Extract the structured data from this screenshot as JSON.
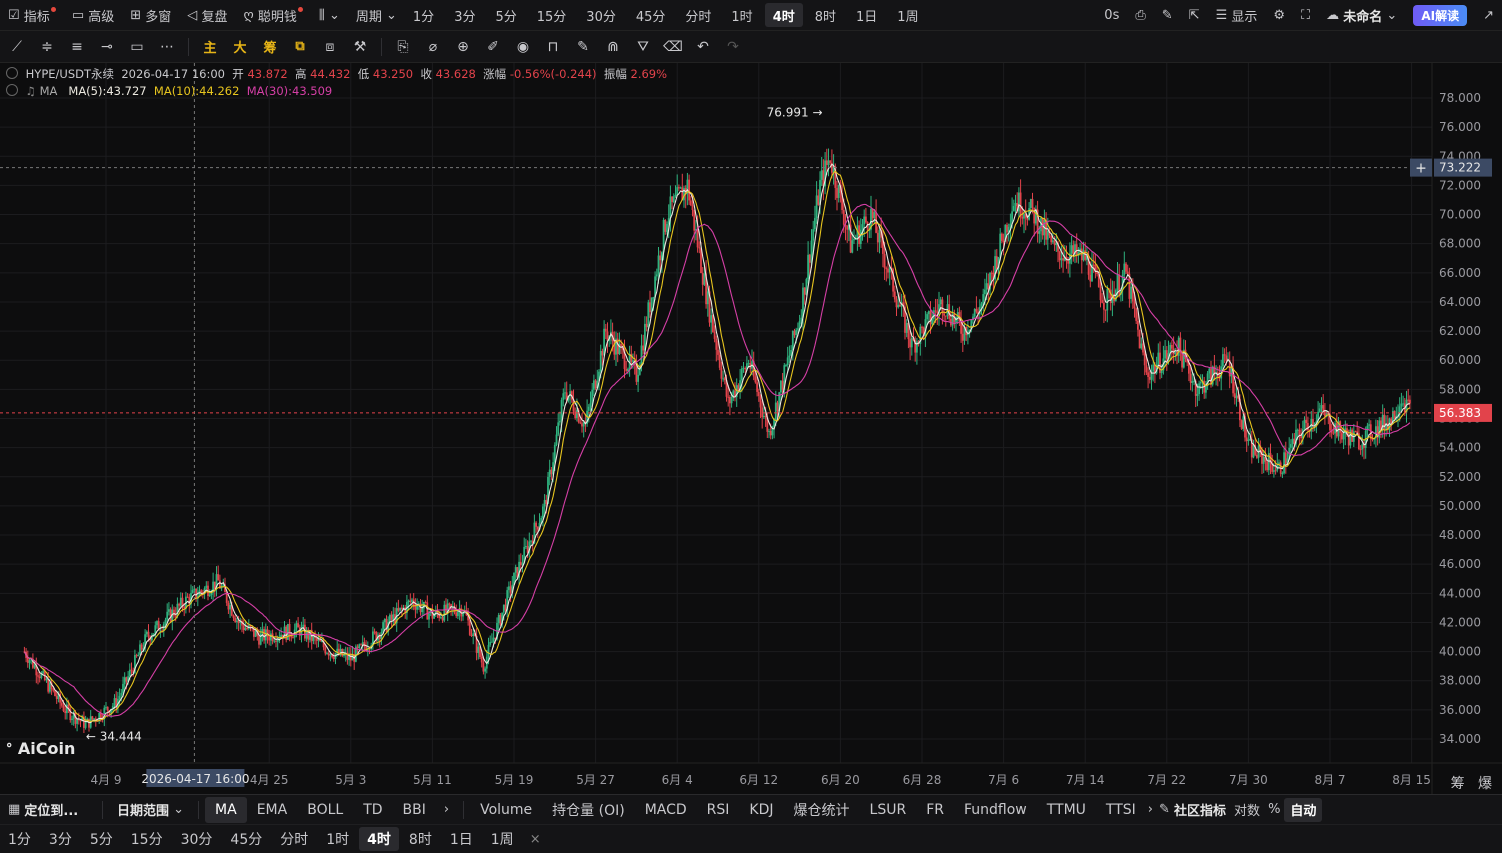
{
  "topbar": {
    "indicators": "指标",
    "advanced": "高级",
    "multi": "多窗",
    "replay": "复盘",
    "smart": "聪明钱",
    "period": "周期",
    "intervals": [
      "1分",
      "3分",
      "5分",
      "15分",
      "30分",
      "45分",
      "分时",
      "1时",
      "4时",
      "8时",
      "1日",
      "1周"
    ],
    "active_interval": "4时",
    "latency": "0s",
    "display": "显示",
    "account": "未命名",
    "ai": "AI解读"
  },
  "toolbar": {
    "main": "主",
    "big": "大",
    "chip": "筹"
  },
  "legend": {
    "symbol": "HYPE/USDT永续",
    "date": "2026-04-17 16:00",
    "open_label": "开",
    "open": "43.872",
    "high_label": "高",
    "high": "44.432",
    "low_label": "低",
    "low": "43.250",
    "close_label": "收",
    "close": "43.628",
    "chg_label": "涨幅",
    "chg": "-0.56%(-0.244)",
    "amp_label": "振幅",
    "amp": "2.69%",
    "ma_name": "MA",
    "ma5": "MA(5):43.727",
    "ma10": "MA(10):44.262",
    "ma30": "MA(30):43.509"
  },
  "colors": {
    "up": "#2fb27f",
    "down": "#e2434b",
    "ma5": "#ece9e0",
    "ma10": "#e7c51f",
    "ma30": "#d53fa6",
    "price": "#e2434b"
  },
  "chart_data": {
    "type": "candlestick",
    "ylim": [
      33,
      79
    ],
    "yticks": [
      "34.000",
      "36.000",
      "38.000",
      "40.000",
      "42.000",
      "44.000",
      "46.000",
      "48.000",
      "50.000",
      "52.000",
      "54.000",
      "56.000",
      "58.000",
      "60.000",
      "62.000",
      "64.000",
      "66.000",
      "68.000",
      "70.000",
      "72.000",
      "74.000",
      "76.000",
      "78.000"
    ],
    "xticks": [
      "4月 9",
      "4月 25",
      "5月 3",
      "5月 11",
      "5月 19",
      "5月 27",
      "6月 4",
      "6月 12",
      "6月 20",
      "6月 28",
      "7月 6",
      "7月 14",
      "7月 22",
      "7月 30",
      "8月 7",
      "8月 15"
    ],
    "crosshair_date": "2026-04-17 16:00",
    "crosshair_price": "73.222",
    "last_price": "56.383",
    "max_label": "76.991",
    "min_label": "34.444",
    "close_path": [
      [
        "4月 1",
        40.0
      ],
      [
        "4月 5",
        36.0
      ],
      [
        "4月 7",
        35.0
      ],
      [
        "4月 10",
        36.5
      ],
      [
        "4月 13",
        41.0
      ],
      [
        "4月 17",
        43.6
      ],
      [
        "4月 20",
        44.8
      ],
      [
        "4月 22",
        42.0
      ],
      [
        "4月 24",
        41.0
      ],
      [
        "4月 28",
        41.5
      ],
      [
        "5月 1",
        40.0
      ],
      [
        "5月 3",
        39.5
      ],
      [
        "5月 6",
        41.5
      ],
      [
        "5月 9",
        43.5
      ],
      [
        "5月 11",
        42.5
      ],
      [
        "5月 14",
        43.0
      ],
      [
        "5月 16",
        39.0
      ],
      [
        "5月 19",
        45.0
      ],
      [
        "5月 22",
        50.0
      ],
      [
        "5月 24",
        58.0
      ],
      [
        "5月 26",
        55.5
      ],
      [
        "5月 28",
        62.0
      ],
      [
        "5月 31",
        59.0
      ],
      [
        "6月 3",
        70.0
      ],
      [
        "6月 5",
        72.0
      ],
      [
        "6月 7",
        64.0
      ],
      [
        "6月 9",
        57.0
      ],
      [
        "6月 11",
        60.0
      ],
      [
        "6月 13",
        55.0
      ],
      [
        "6月 16",
        63.0
      ],
      [
        "6月 18",
        72.0
      ],
      [
        "6月 19",
        74.0
      ],
      [
        "6月 21",
        68.0
      ],
      [
        "6月 23",
        70.0
      ],
      [
        "6月 25",
        65.5
      ],
      [
        "6月 27",
        61.0
      ],
      [
        "6月 30",
        64.0
      ],
      [
        "7月 2",
        62.0
      ],
      [
        "7月 4",
        64.0
      ],
      [
        "7月 7",
        71.0
      ],
      [
        "7月 9",
        70.0
      ],
      [
        "7月 11",
        67.5
      ],
      [
        "7月 14",
        67.0
      ],
      [
        "7月 16",
        64.0
      ],
      [
        "7月 18",
        66.0
      ],
      [
        "7月 20",
        59.0
      ],
      [
        "7月 23",
        61.0
      ],
      [
        "7月 25",
        58.0
      ],
      [
        "7月 28",
        60.0
      ],
      [
        "7月 30",
        54.0
      ],
      [
        "8月 2",
        52.5
      ],
      [
        "8月 4",
        55.0
      ],
      [
        "8月 6",
        56.5
      ],
      [
        "8月 8",
        55.0
      ],
      [
        "8月 10",
        54.5
      ],
      [
        "8月 13",
        56.0
      ],
      [
        "8月 14",
        57.5
      ],
      [
        "8月 15",
        56.383
      ]
    ],
    "legend_position": "top-left"
  },
  "watermark": "AiCoin",
  "indbar": {
    "locate": "定位到...",
    "range": "日期范围",
    "main_inds": [
      "MA",
      "EMA",
      "BOLL",
      "TD",
      "BBI"
    ],
    "sub_inds": [
      "Volume",
      "持仓量 (OI)",
      "MACD",
      "RSI",
      "KDJ",
      "爆仓统计",
      "LSUR",
      "FR",
      "Fundflow",
      "TTMU",
      "TTSI"
    ],
    "community": "社区指标",
    "log": "对数",
    "pct": "%",
    "auto": "自动"
  },
  "perbar": {
    "intervals": [
      "1分",
      "3分",
      "5分",
      "15分",
      "30分",
      "45分",
      "分时",
      "1时",
      "4时",
      "8时",
      "1日",
      "1周"
    ],
    "active": "4时",
    "close": "×"
  },
  "side": {
    "chip": "筹",
    "boom": "爆"
  }
}
